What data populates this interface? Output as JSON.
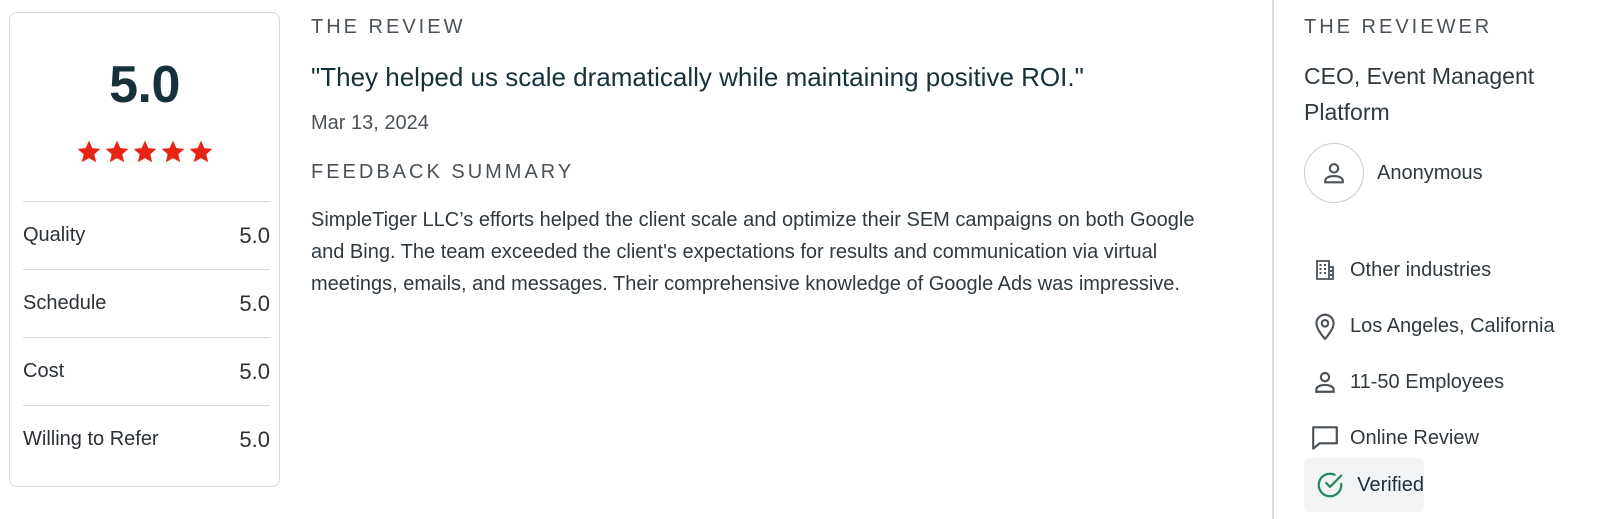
{
  "rating": {
    "overall": "5.0",
    "stars": 5,
    "star_color": "#e62415",
    "metrics": [
      {
        "label": "Quality",
        "value": "5.0"
      },
      {
        "label": "Schedule",
        "value": "5.0"
      },
      {
        "label": "Cost",
        "value": "5.0"
      },
      {
        "label": "Willing to Refer",
        "value": "5.0"
      }
    ]
  },
  "review": {
    "section_title": "THE REVIEW",
    "quote": "\"They helped us scale dramatically while maintaining positive ROI.\"",
    "date": "Mar 13, 2024",
    "summary_title": "FEEDBACK SUMMARY",
    "summary": "SimpleTiger LLC’s efforts helped the client scale and optimize their SEM campaigns on both Google and Bing. The team exceeded the client's expectations for results and communication via virtual meetings, emails, and messages. Their comprehensive knowledge of Google Ads was impressive."
  },
  "reviewer": {
    "section_title": "THE REVIEWER",
    "role": "CEO, Event Managent Platform",
    "name": "Anonymous",
    "avatar_icon": "person-icon",
    "details": [
      {
        "icon": "building-icon",
        "text": "Other industries"
      },
      {
        "icon": "location-pin-icon",
        "text": "Los Angeles, California"
      },
      {
        "icon": "person-icon",
        "text": "11-50 Employees"
      },
      {
        "icon": "chat-bubble-icon",
        "text": "Online Review"
      }
    ],
    "verified": {
      "icon": "check-circle-icon",
      "text": "Verified",
      "color": "#1e8a5a"
    }
  }
}
